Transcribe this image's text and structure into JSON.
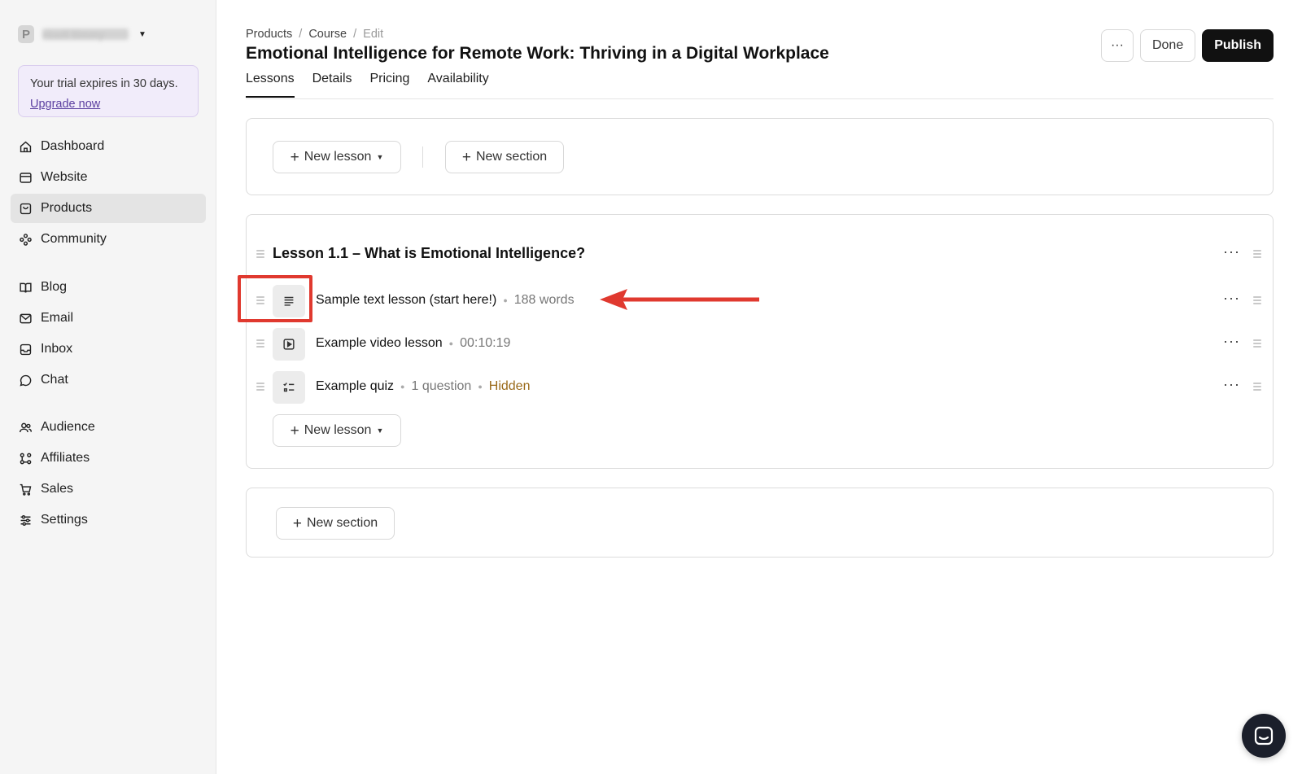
{
  "workspace": {
    "initial": "P",
    "name": "Hoofi Bmmy"
  },
  "trial": {
    "text": "Your trial expires in 30 days.",
    "link": "Upgrade now"
  },
  "nav": {
    "group1": [
      {
        "label": "Dashboard",
        "icon": "home-icon"
      },
      {
        "label": "Website",
        "icon": "browser-icon"
      },
      {
        "label": "Products",
        "icon": "bag-icon",
        "active": true
      },
      {
        "label": "Community",
        "icon": "community-icon"
      }
    ],
    "group2": [
      {
        "label": "Blog",
        "icon": "book-icon"
      },
      {
        "label": "Email",
        "icon": "mail-icon"
      },
      {
        "label": "Inbox",
        "icon": "inbox-icon"
      },
      {
        "label": "Chat",
        "icon": "chat-icon"
      }
    ],
    "group3": [
      {
        "label": "Audience",
        "icon": "users-icon"
      },
      {
        "label": "Affiliates",
        "icon": "affiliates-icon"
      },
      {
        "label": "Sales",
        "icon": "cart-icon"
      },
      {
        "label": "Settings",
        "icon": "sliders-icon"
      }
    ]
  },
  "breadcrumb": {
    "products": "Products",
    "sep": "/",
    "course": "Course",
    "edit": "Edit"
  },
  "page_title": "Emotional Intelligence for Remote Work: Thriving in a Digital Workplace",
  "tabs": [
    "Lessons",
    "Details",
    "Pricing",
    "Availability"
  ],
  "actions": {
    "more": "···",
    "done": "Done",
    "publish": "Publish"
  },
  "toolbar": {
    "new_lesson": "New lesson",
    "new_section": "New section"
  },
  "section": {
    "title": "Lesson 1.1 – What is Emotional Intelligence?",
    "lessons": [
      {
        "title": "Sample text lesson (start here!)",
        "meta": "188 words",
        "icon": "text-lines-icon"
      },
      {
        "title": "Example video lesson",
        "meta": "00:10:19",
        "icon": "video-icon"
      },
      {
        "title": "Example quiz",
        "meta": "1 question",
        "status": "Hidden",
        "icon": "quiz-checklist-icon"
      }
    ],
    "new_lesson": "New lesson"
  },
  "footer_section": {
    "new_section": "New section"
  },
  "colors": {
    "accent_dark": "#111111",
    "highlight_red": "#e0392f",
    "hidden_status": "#9a6a1a",
    "trial_bg": "#f1ecfa"
  }
}
